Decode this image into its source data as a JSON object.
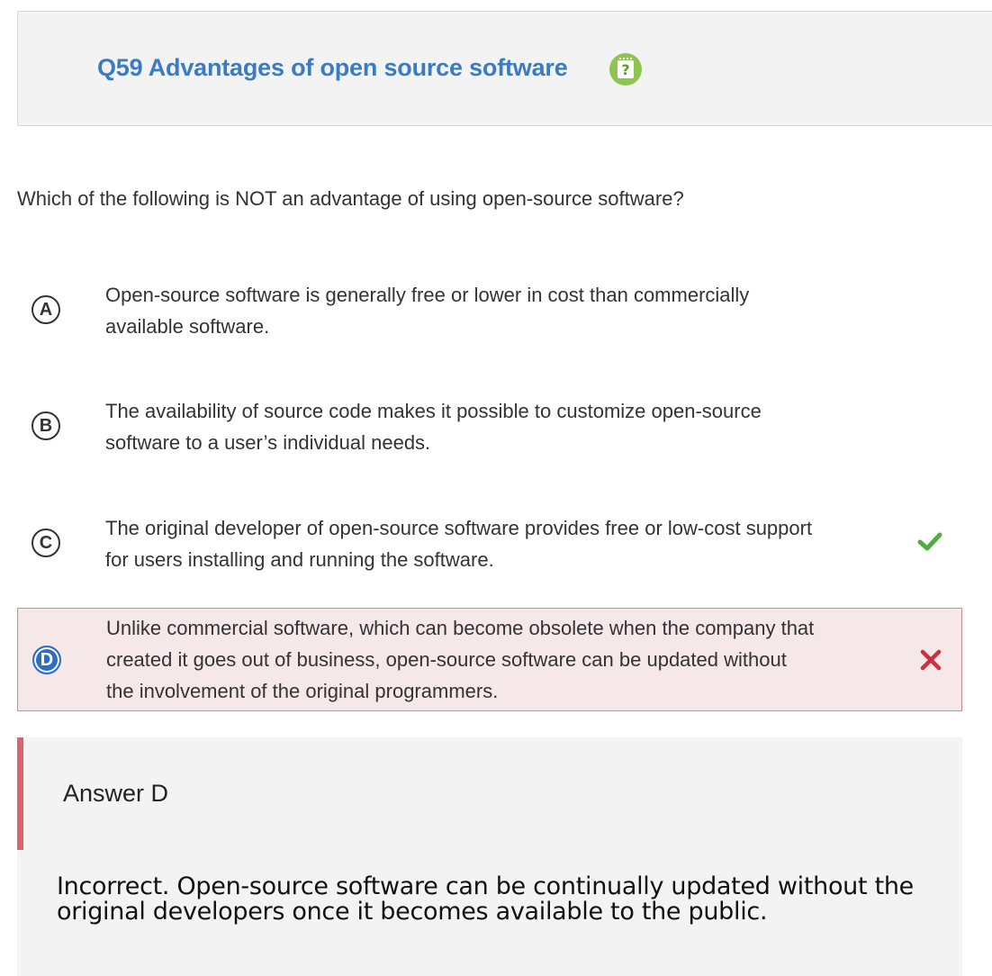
{
  "header": {
    "title": "Q59 Advantages of open source software",
    "help_icon": "notepad-question-icon",
    "help_glyph": "?",
    "help_icon_color": "#8ec54e",
    "title_color": "#3a7cc3"
  },
  "question": "Which of the following is NOT an advantage of using open-source software?",
  "options": [
    {
      "letter": "A",
      "text": "Open-source software is generally free or lower in cost than commercially available software.",
      "mark": ""
    },
    {
      "letter": "B",
      "text": "The availability of source code makes it possible to customize open-source software to a user’s individual needs.",
      "mark": ""
    },
    {
      "letter": "C",
      "text": "The original developer of open-source software provides free or low-cost support for users installing and running the software.",
      "mark": "correct-check-icon"
    },
    {
      "letter": "D",
      "text": "Unlike commercial software, which can become obsolete when the company that created it goes out of business, open-source software can be updated without the involvement of the original programmers.",
      "mark": "incorrect-x-icon",
      "selected": true
    }
  ],
  "answer": {
    "label": "Answer D",
    "explanation": "Incorrect. Open-source software can be continually updated without the original developers once it becomes available to the public."
  },
  "colors": {
    "correct": "#4caf3f",
    "incorrect": "#c9313f",
    "selected_bg": "#f6e8e9",
    "answer_bar": "#d9646f"
  }
}
